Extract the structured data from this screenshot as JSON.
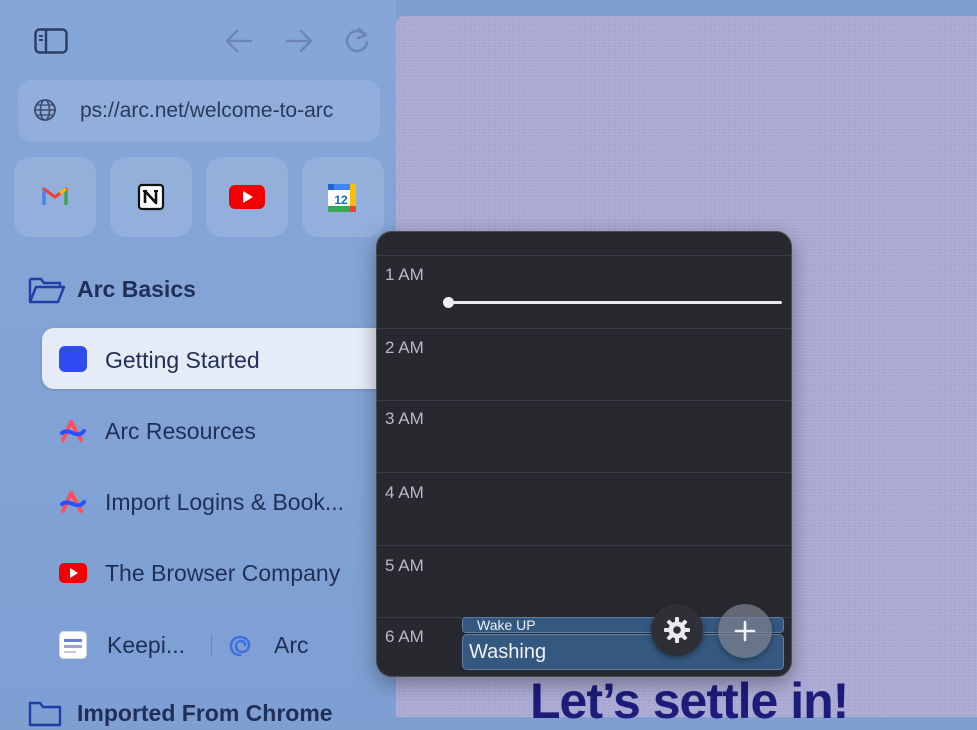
{
  "browser": {
    "url": "ps://arc.net/welcome-to-arc",
    "favorites": [
      {
        "name": "gmail"
      },
      {
        "name": "notion"
      },
      {
        "name": "youtube"
      },
      {
        "name": "calendar",
        "label": "12"
      }
    ]
  },
  "sidebar": {
    "folder1": "Arc Basics",
    "tabs": [
      {
        "label": "Getting Started"
      },
      {
        "label": "Arc Resources"
      },
      {
        "label": "Import Logins & Book..."
      },
      {
        "label": "The Browser Company"
      }
    ],
    "split": {
      "left": "Keepi...",
      "right": "Arc"
    },
    "folder2": "Imported From Chrome"
  },
  "content": {
    "hero": "Let’s settle in!"
  },
  "calendar": {
    "hours": [
      "1 AM",
      "2 AM",
      "3 AM",
      "4 AM",
      "5 AM",
      "6 AM"
    ],
    "events": {
      "small": "Wake UP",
      "large": "Washing"
    }
  },
  "colors": {
    "sidebar_bg": "#84a4d7",
    "content_bg": "#a9a8d3",
    "popup_bg": "#28292f",
    "event_bg": "#34587f",
    "accent_blue": "#2f4cf0",
    "hero_text": "#1d1c7a"
  }
}
